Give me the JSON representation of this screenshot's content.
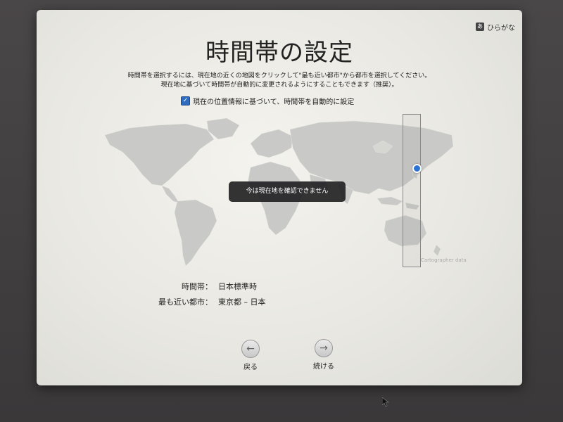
{
  "header": {
    "input_menu": {
      "icon": "input-method-icon",
      "label": "ひらがな"
    },
    "title": "時間帯の設定"
  },
  "instructions": {
    "line1": "時間帯を選択するには、現在地の近くの地図をクリックして\"最も近い都市\"から都市を選択してください。",
    "line2": "現在地に基づいて時間帯が自動的に変更されるようにすることもできます（推奨）。"
  },
  "auto_timezone": {
    "checked": true,
    "label": "現在の位置情報に基づいて、時間帯を自動的に設定"
  },
  "map": {
    "toast": "今は現在地を確認できません",
    "credit": "Cartographer data"
  },
  "info": {
    "timezone_label": "時間帯：",
    "timezone_value": "日本標準時",
    "city_label": "最も近い都市：",
    "city_value": "東京都 – 日本"
  },
  "nav": {
    "back_label": "戻る",
    "back_icon": "arrow-left-icon",
    "continue_label": "続ける",
    "continue_icon": "arrow-right-icon"
  },
  "colors": {
    "accent": "#2f6cc0",
    "pin": "#2d73d4",
    "toast_bg": "#1e1e20",
    "land": "#c9c9c7"
  }
}
